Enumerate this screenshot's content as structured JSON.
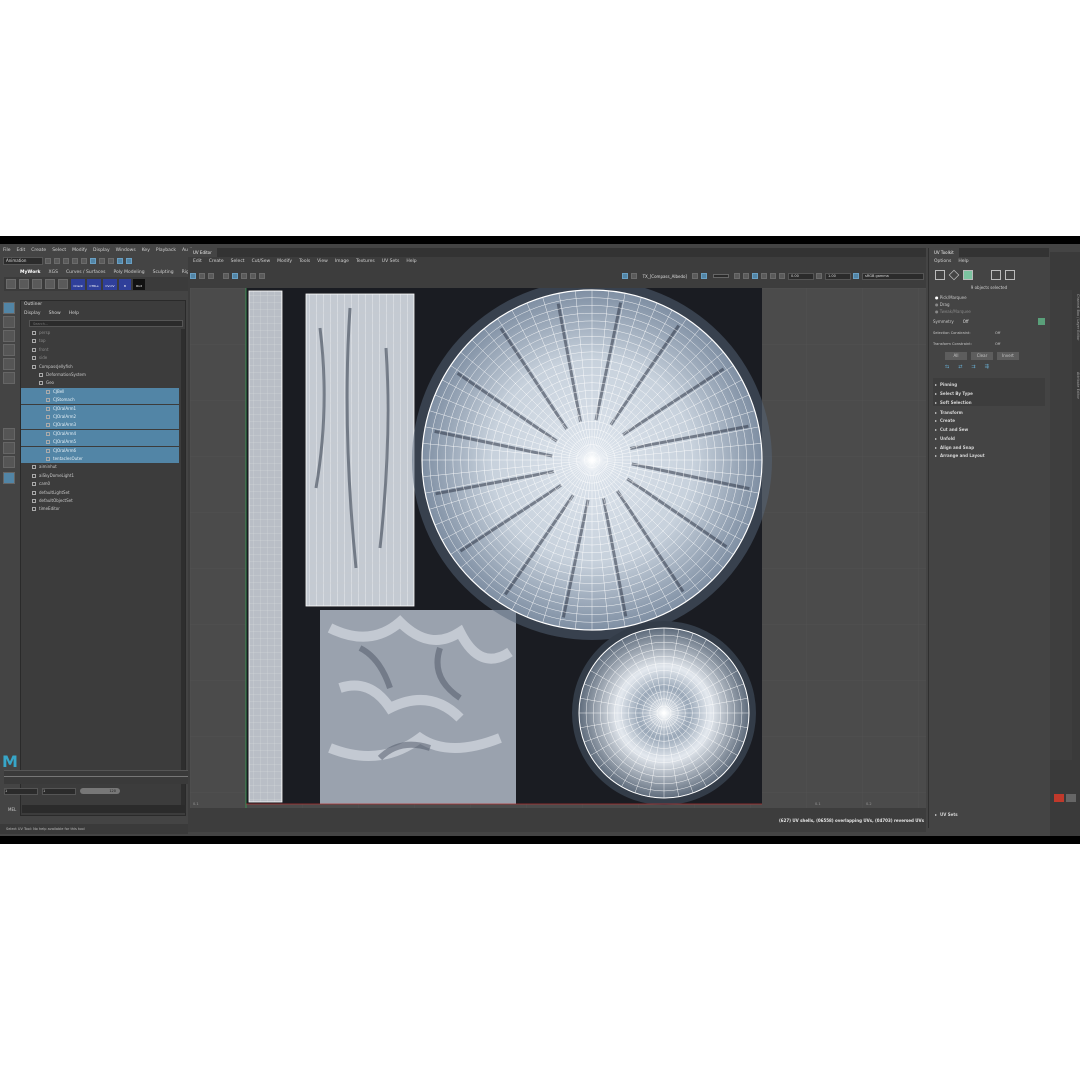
{
  "main_menu": [
    "File",
    "Edit",
    "Create",
    "Select",
    "Modify",
    "Display",
    "Windows",
    "Key",
    "Playback",
    "Audi"
  ],
  "mode_dropdown": "Animation",
  "shelf_tabs": [
    "MyWork",
    "XGS",
    "Curves / Surfaces",
    "Poly Modeling",
    "Sculpting",
    "Rig"
  ],
  "shelf_buttons": [
    "Orient",
    "CTRLs",
    "CV-CV",
    "B",
    "Rivt"
  ],
  "outliner": {
    "title": "Outliner",
    "menus": [
      "Display",
      "Show",
      "Help"
    ],
    "search_placeholder": "Search...",
    "items": [
      {
        "label": "persp",
        "depth": 1,
        "selected": false,
        "dim": true
      },
      {
        "label": "top",
        "depth": 1,
        "selected": false,
        "dim": true
      },
      {
        "label": "front",
        "depth": 1,
        "selected": false,
        "dim": true
      },
      {
        "label": "side",
        "depth": 1,
        "selected": false,
        "dim": true
      },
      {
        "label": "CompassJellyfish",
        "depth": 1,
        "selected": false,
        "dim": false
      },
      {
        "label": "DeformationSystem",
        "depth": 2,
        "selected": false,
        "dim": false
      },
      {
        "label": "Geo",
        "depth": 2,
        "selected": false,
        "dim": false
      },
      {
        "label": "CJBell",
        "depth": 3,
        "selected": true,
        "dim": false
      },
      {
        "label": "CJStomach",
        "depth": 3,
        "selected": true,
        "dim": true
      },
      {
        "label": "CJOralArm1",
        "depth": 3,
        "selected": true,
        "dim": false
      },
      {
        "label": "CJOralArm2",
        "depth": 3,
        "selected": true,
        "dim": false
      },
      {
        "label": "CJOralArm3",
        "depth": 3,
        "selected": true,
        "dim": false
      },
      {
        "label": "CJOralArm4",
        "depth": 3,
        "selected": true,
        "dim": false
      },
      {
        "label": "CJOralArm5",
        "depth": 3,
        "selected": true,
        "dim": false
      },
      {
        "label": "CJOralArm6",
        "depth": 3,
        "selected": true,
        "dim": false
      },
      {
        "label": "tentaclesOuter",
        "depth": 3,
        "selected": true,
        "dim": false
      },
      {
        "label": "aiminhut",
        "depth": 1,
        "selected": false,
        "dim": false
      },
      {
        "label": "aiSkyDomeLight1",
        "depth": 1,
        "selected": false,
        "dim": false
      },
      {
        "label": "cam0",
        "depth": 1,
        "selected": false,
        "dim": false
      },
      {
        "label": "defaultLightSet",
        "depth": 1,
        "selected": false,
        "dim": false
      },
      {
        "label": "defaultObjectSet",
        "depth": 1,
        "selected": false,
        "dim": false
      },
      {
        "label": "timeEditor",
        "depth": 1,
        "selected": false,
        "dim": false
      }
    ]
  },
  "timeline": {
    "start": "1",
    "end": "1",
    "range_end": "120"
  },
  "mel_label": "MEL",
  "status_help": "Select UV Tool: No help available for this tool",
  "uv_editor": {
    "tab": "UV Editor",
    "menus": [
      "Edit",
      "Create",
      "Select",
      "Cut/Sew",
      "Modify",
      "Tools",
      "View",
      "Image",
      "Textures",
      "UV Sets",
      "Help"
    ],
    "texture_name": "TX_[Compass_Albedo]",
    "field_a": "0.00",
    "field_b": "1.00",
    "colorspace": "sRGB gamma",
    "status": "(627) UV shells, (06558) overlapping UVs, (04703) reversed UVs",
    "axis_labels": [
      "0.1",
      "0.1",
      "0.2"
    ]
  },
  "uv_toolkit": {
    "tab": "UV Toolkit",
    "menus": [
      "Options",
      "Help"
    ],
    "objects_selected": "9 objects selected",
    "pick_modes": [
      "Pick/Marquee",
      "Drag",
      "Tweak/Marquee"
    ],
    "symmetry_label": "Symmetry",
    "symmetry_value": "Off",
    "constraints": [
      {
        "label": "Selection Constraint:",
        "value": "Off"
      },
      {
        "label": "Transform Constraint:",
        "value": "Off"
      }
    ],
    "buttons": [
      "All",
      "Clear",
      "Invert"
    ],
    "sections_top": [
      "Pinning",
      "Select By Type",
      "Soft Selection"
    ],
    "sections": [
      "Transform",
      "Create",
      "Cut and Sew",
      "Unfold",
      "Align and Snap",
      "Arrange and Layout"
    ],
    "uv_sets": "UV Sets"
  },
  "right_tabs": [
    "Channel Box / Layer Editor",
    "Attribute Editor"
  ],
  "colors": {
    "panel": "#444444",
    "selection": "#5285a6",
    "texture_bg": "#1a1c22",
    "wire": "#ffffff"
  },
  "logo_letter": "M"
}
